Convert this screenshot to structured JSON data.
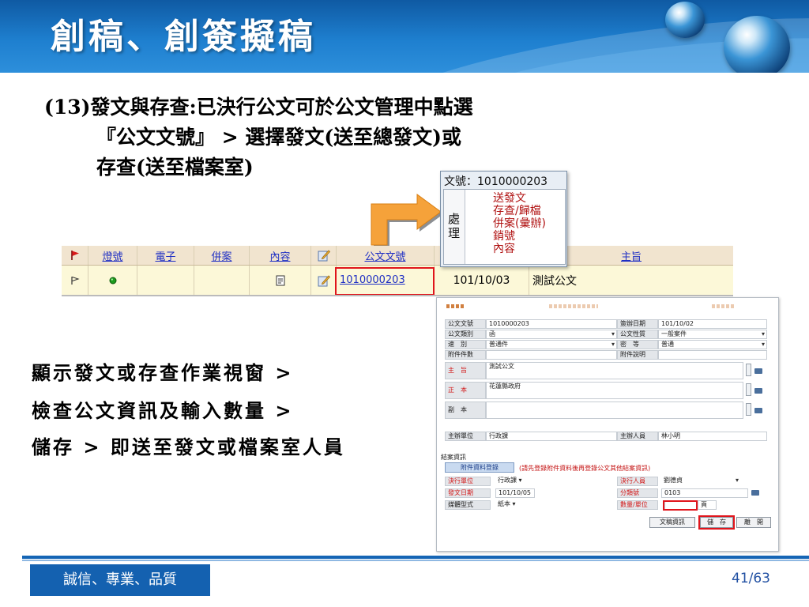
{
  "slide": {
    "title": "創稿、創簽擬稿",
    "instruction_lines": [
      "(13)發文與存查:已決行公文可於公文管理中點選",
      "『公文文號』 > 選擇發文(送至總發文)或",
      "存查(送至檔案室)"
    ],
    "steps": [
      "顯示發文或存查作業視窗 >",
      "檢查公文資訊及輸入數量 >",
      "儲存 > 即送至發文或檔案室人員"
    ],
    "footer_motto": "誠信、專業、品質",
    "page_number": "41/63"
  },
  "popup": {
    "label": "文號：",
    "doc_number": "1010000203",
    "side_label": "處\n理",
    "options": [
      "送發文",
      "存查/歸檔",
      "併案(彙辦)",
      "銷號",
      "內容"
    ]
  },
  "list_table": {
    "headers": [
      "",
      "燈號",
      "電子",
      "併案",
      "內容",
      "",
      "公文文號",
      "",
      "主旨"
    ],
    "row": {
      "doc_number": "1010000203",
      "date": "101/10/03",
      "subject": "測試公文"
    }
  },
  "dialog": {
    "fields": {
      "doc_no_label": "公文文號",
      "doc_no": "1010000203",
      "sign_date_label": "簽辦日期",
      "sign_date": "101/10/02",
      "category_label": "公文類別",
      "category": "函",
      "nature_label": "公文性質",
      "nature": "一般案件",
      "speed_label": "速　別",
      "speed": "普通件",
      "secret_label": "密　等",
      "secret": "普通",
      "attach_count_label": "附件件數",
      "attach_count": "",
      "attach_desc_label": "附件說明",
      "attach_desc": "",
      "subject_label": "主　旨",
      "subject": "測試公文",
      "main_to_label": "正　本",
      "main_to": "花蓮縣政府",
      "copy_to_label": "副　本",
      "copy_to": "",
      "host_unit_label": "主辦單位",
      "host_unit": "行政課",
      "host_person_label": "主辦人員",
      "host_person": "林小明"
    },
    "close_section_label": "結案資訊",
    "attach_tab": "附件資料登錄",
    "attach_hint": "(請先登錄附件資料後再登錄公文其他結案資訊)",
    "close_fields": {
      "decide_unit_label": "決行單位",
      "decide_unit": "行政課",
      "decide_person_label": "決行人員",
      "decide_person": "劉德貞",
      "send_date_label": "發文日期",
      "send_date": "101/10/05",
      "class_no_label": "分類號",
      "class_no": "0103",
      "media_label": "媒體型式",
      "media": "紙本",
      "qty_label": "數量/單位",
      "qty": "",
      "unit": "頁"
    },
    "buttons": {
      "draft": "文稿資訊",
      "save": "儲　存",
      "leave": "離　開"
    }
  },
  "colors": {
    "header_blue": "#1e7fcf",
    "highlight_red": "#e0151c",
    "arrow_orange": "#f5a23a",
    "link_blue": "#1f2fc4",
    "option_red": "#b01212"
  }
}
